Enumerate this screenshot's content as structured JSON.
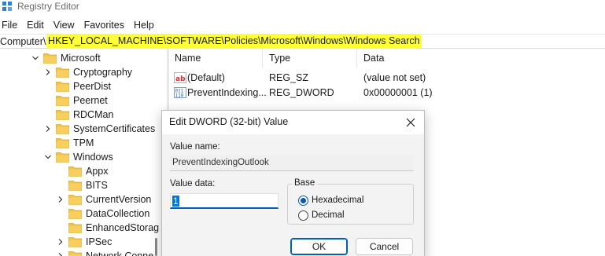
{
  "window": {
    "title": "Registry Editor"
  },
  "menu": [
    "File",
    "Edit",
    "View",
    "Favorites",
    "Help"
  ],
  "address": {
    "prefix": "Computer\\",
    "path": "HKEY_LOCAL_MACHINE\\SOFTWARE\\Policies\\Microsoft\\Windows\\Windows Search"
  },
  "tree": {
    "items": [
      {
        "label": "Microsoft",
        "expanded": true
      },
      {
        "label": "Cryptography",
        "expanded": false
      },
      {
        "label": "PeerDist",
        "expanded": null
      },
      {
        "label": "Peernet",
        "expanded": null
      },
      {
        "label": "RDCMan",
        "expanded": null
      },
      {
        "label": "SystemCertificates",
        "expanded": false
      },
      {
        "label": "TPM",
        "expanded": null
      },
      {
        "label": "Windows",
        "expanded": true
      },
      {
        "label": "Appx",
        "expanded": null
      },
      {
        "label": "BITS",
        "expanded": null
      },
      {
        "label": "CurrentVersion",
        "expanded": false
      },
      {
        "label": "DataCollection",
        "expanded": null
      },
      {
        "label": "EnhancedStorag",
        "expanded": null
      },
      {
        "label": "IPSec",
        "expanded": false
      },
      {
        "label": "Network Conne",
        "expanded": false
      }
    ]
  },
  "list": {
    "columns": [
      "Name",
      "Type",
      "Data"
    ],
    "rows": [
      {
        "icon": "string-value-icon",
        "name": "(Default)",
        "type": "REG_SZ",
        "data": "(value not set)"
      },
      {
        "icon": "binary-value-icon",
        "name": "PreventIndexing...",
        "type": "REG_DWORD",
        "data": "0x00000001 (1)"
      }
    ]
  },
  "dialog": {
    "title": "Edit DWORD (32-bit) Value",
    "value_name_label": "Value name:",
    "value_name": "PreventIndexingOutlook",
    "value_data_label": "Value data:",
    "value_data": "1",
    "base_label": "Base",
    "base_options": [
      {
        "label": "Hexadecimal",
        "selected": true
      },
      {
        "label": "Decimal",
        "selected": false
      }
    ],
    "ok_label": "OK",
    "cancel_label": "Cancel"
  },
  "colors": {
    "highlight": "#ffff3a",
    "accent": "#005fb8",
    "folder": "#f2c34c"
  }
}
